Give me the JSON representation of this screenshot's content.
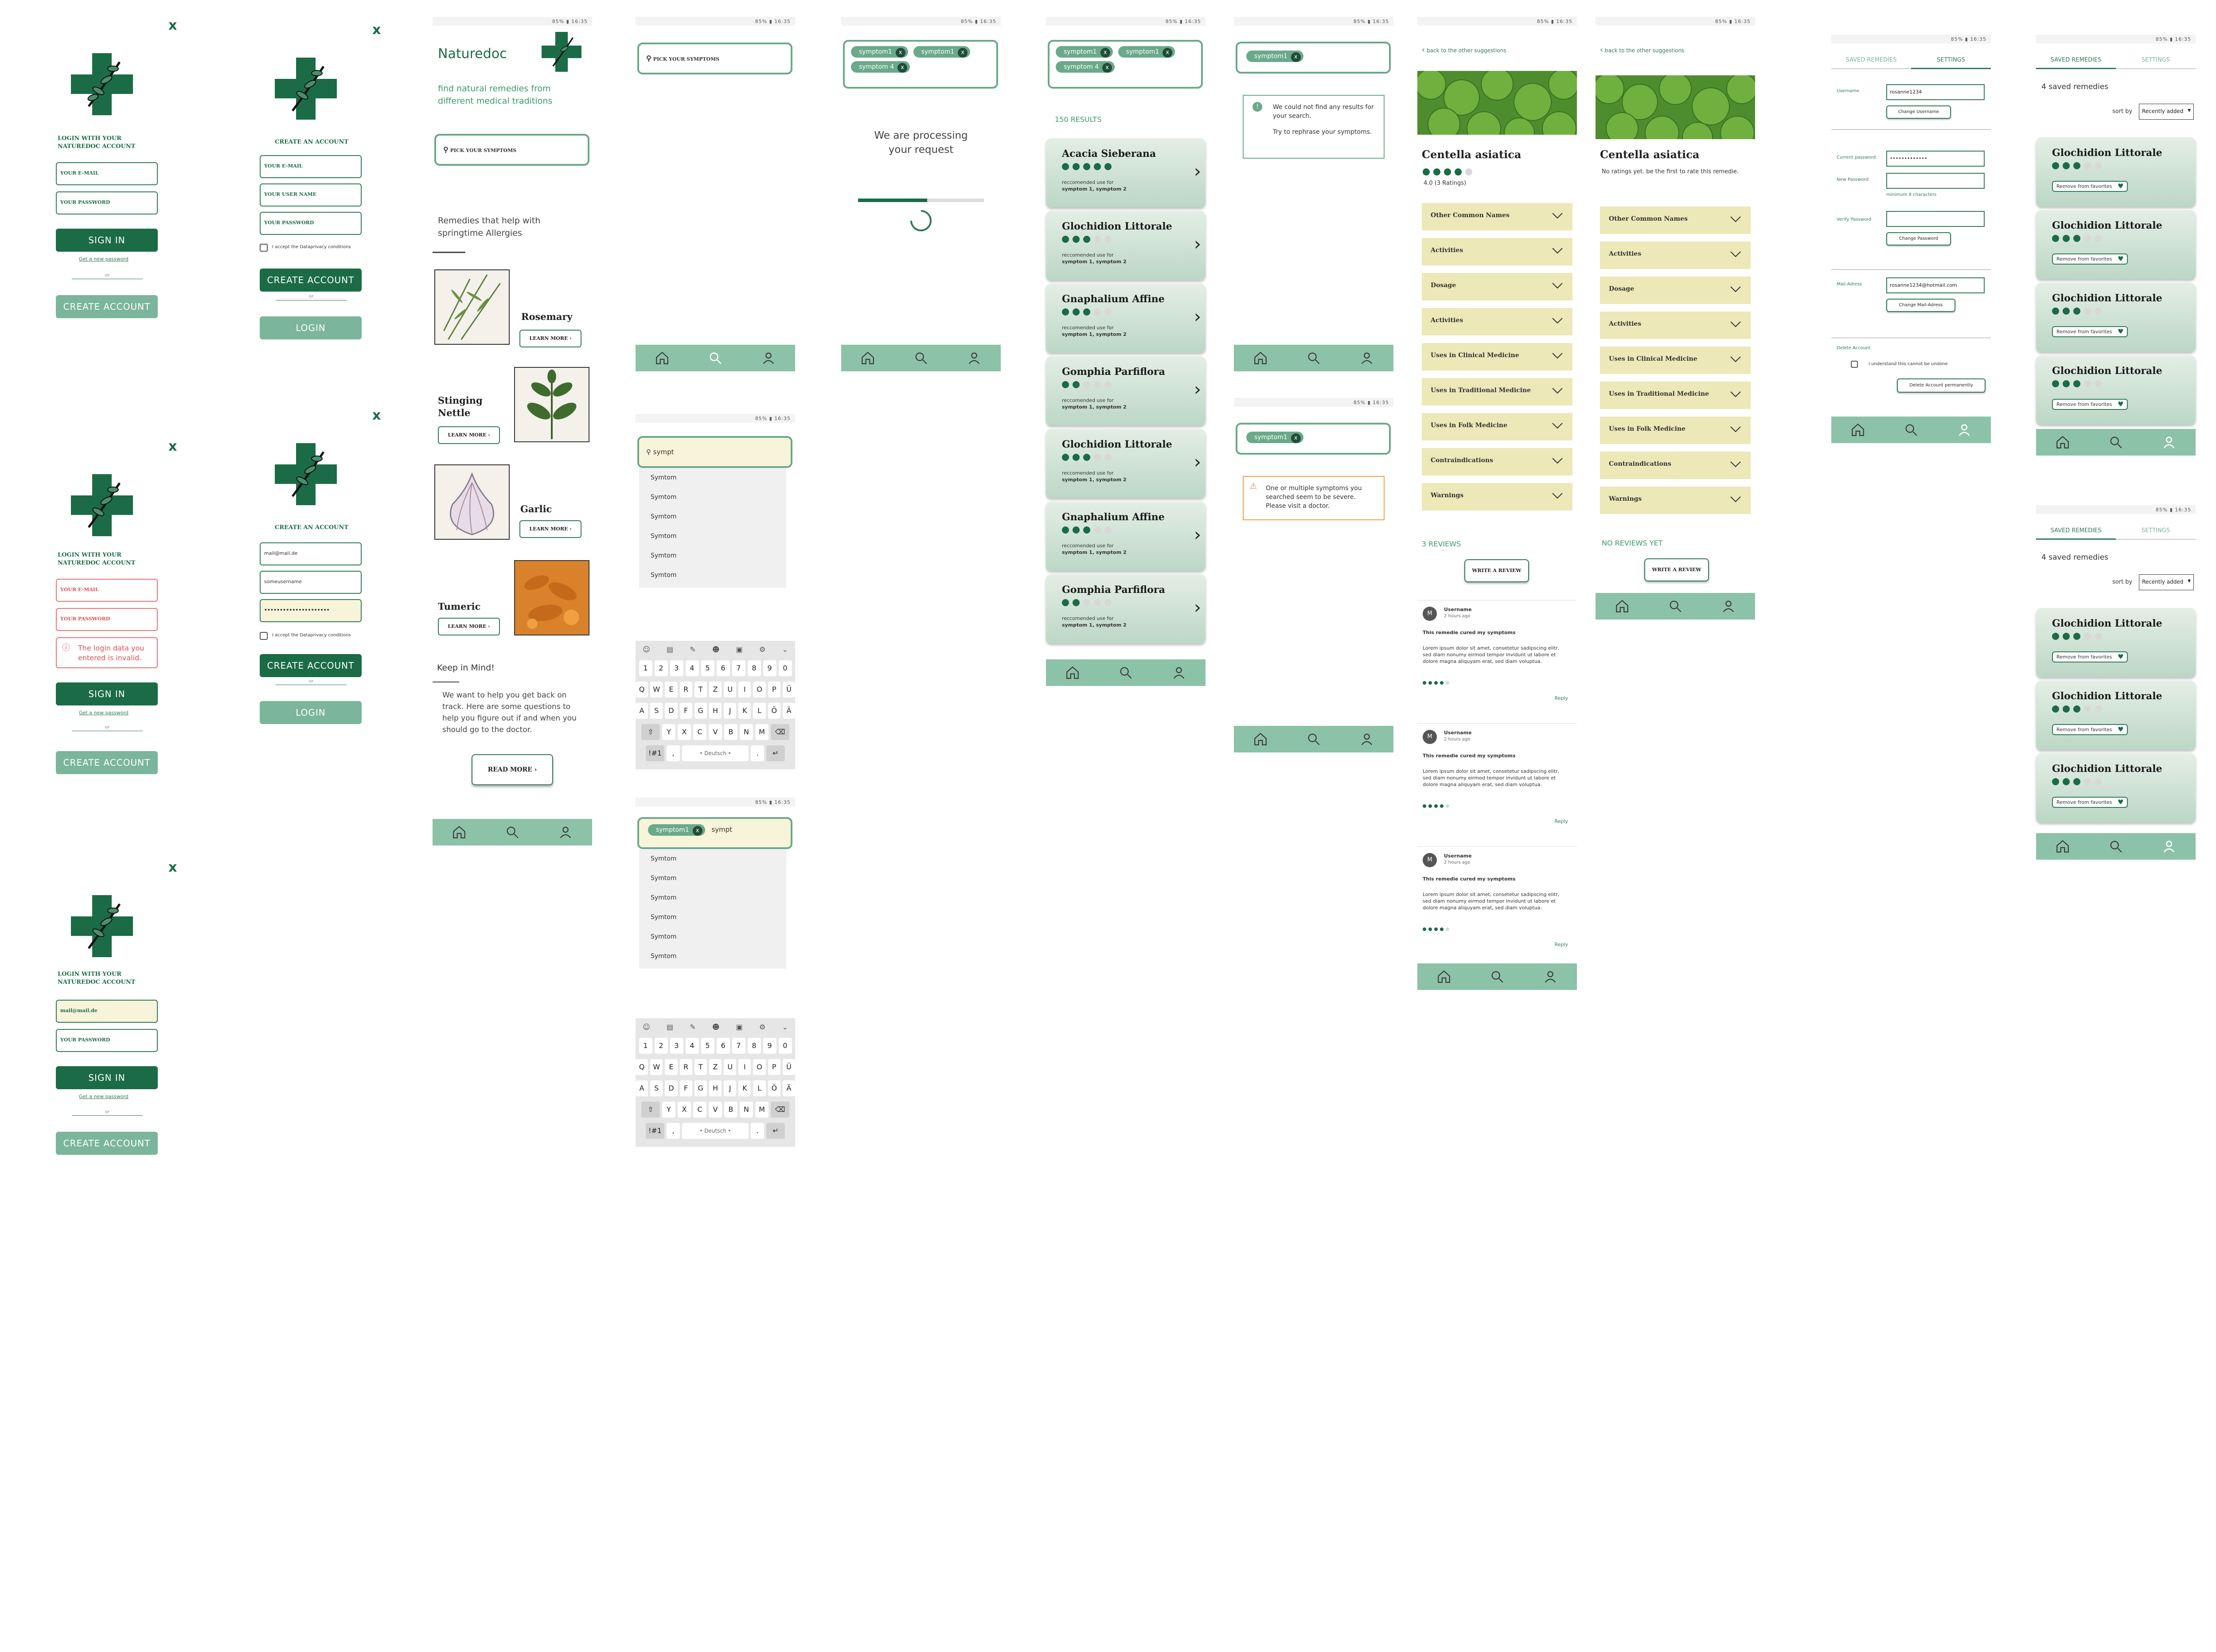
{
  "status": {
    "text": "85% ▮ 16:35"
  },
  "colors": {
    "primary": "#1b6b47",
    "accent": "#7bb59b",
    "nav": "#8cc2a8",
    "error": "#f07070",
    "card": "#bcd7c6",
    "accordion": "#ece8b8"
  },
  "login": {
    "title": "LOGIN WITH YOUR NATUREDOC ACCOUNT",
    "email_ph": "YOUR E-MAIL",
    "password_ph": "YOUR PASSWORD",
    "sign_in": "SIGN IN",
    "forgot": "Get a new password",
    "or": "or",
    "create": "CREATE ACCOUNT",
    "error_text": "The login data you entered is invalid.",
    "filled_email": "mail@mail.de"
  },
  "register": {
    "title": "CREATE AN ACCOUNT",
    "email_ph": "YOUR E-MAIL",
    "user_ph": "YOUR USER NAME",
    "password_ph": "YOUR PASSWORD",
    "accept": "I accept the Dataprivacy conditions",
    "create": "CREATE ACCOUNT",
    "or": "or",
    "login": "LOGIN",
    "filled_email": "mail@mail.de",
    "filled_user": "someusername",
    "filled_pw": "•••••••••••••••••••••"
  },
  "home": {
    "app_name": "Naturedoc",
    "tagline": "find natural remedies from different medical traditions",
    "search_ph": "PICK YOUR SYMPTOMS",
    "section_title": "Remedies that help with springtime Allergies",
    "remedies": [
      {
        "name": "Rosemary",
        "btn": "LEARN MORE"
      },
      {
        "name": "Stinging Nettle",
        "btn": "LEARN MORE"
      },
      {
        "name": "Garlic",
        "btn": "LEARN MORE"
      },
      {
        "name": "Tumeric",
        "btn": "LEARN MORE"
      }
    ],
    "keep_title": "Keep in Mind!",
    "keep_text": "We want to help you get back on track. Here are some questions to help you figure out if and when you should go to the doctor.",
    "read_more": "READ MORE"
  },
  "search": {
    "placeholder": "PICK YOUR SYMPTOMS",
    "typed": "sympt",
    "suggestion": "Symtom",
    "chip1": "symptom1",
    "chip2": "symptom1",
    "chip3": "symptom 4",
    "keyboard_lang": "• Deutsch •",
    "mode": "!#1"
  },
  "processing": {
    "text": "We are processing your request",
    "progress": 0.55
  },
  "results": {
    "count": "150 RESULTS",
    "rec_label": "reccomended use for",
    "rec_value": "symptom 1, symptom 2",
    "items": [
      {
        "name": "Acacia Sieberana",
        "rating": 5
      },
      {
        "name": "Glochidion Littorale",
        "rating": 3
      },
      {
        "name": "Gnaphalium Affine",
        "rating": 3
      },
      {
        "name": "Gomphia Parfiflora",
        "rating": 2
      },
      {
        "name": "Glochidion Littorale",
        "rating": 3
      },
      {
        "name": "Gnaphalium Affine",
        "rating": 3
      },
      {
        "name": "Gomphia Parfiflora",
        "rating": 2
      }
    ]
  },
  "notfound": {
    "chip": "symptom1",
    "msg1": "We could not find any results for your search.",
    "msg2": "Try to rephrase your symptoms.",
    "warn": "One or multiple symptoms you searched seem to be severe. Please visit a doctor."
  },
  "detail": {
    "back": "back to the other suggestions",
    "name": "Centella asiatica",
    "rating_text": "4.0 (3 Ratings)",
    "no_rating": "No ratings yet. be the first to rate this remedie.",
    "sections": [
      "Other Common Names",
      "Activities",
      "Dosage",
      "Activities",
      "Uses in Clinical Medicine",
      "Uses in Traditional Medicine",
      "Uses in Folk Medicine",
      "Contraindications",
      "Warnings"
    ],
    "reviews_count": "3 REVIEWS",
    "no_reviews": "NO REVIEWS YET",
    "write_review": "WRITE A REVIEW",
    "review_user": "Username",
    "review_time": "2 hours ago",
    "review_title": "This remedie cured my symptoms",
    "review_body": "Lorem ipsum dolor sit amet, consetetur sadipscing elitr, sed diam nonumy eirmod tempor invidunt ut labore et dolore magna aliquyam erat, sed diam voluptua.",
    "reply": "Reply"
  },
  "settings": {
    "tab_saved": "SAVED REMEDIES",
    "tab_settings": "SETTINGS",
    "username_label": "Username",
    "username_value": "rosanne1234",
    "change_username": "Change Username",
    "current_pw": "Current password",
    "current_pw_value": "•••••••••••••",
    "new_pw": "New Password",
    "min_chars": "minimum 8 characters",
    "verify_pw": "Verify Password",
    "change_pw": "Change Password",
    "mail_label": "Mail-Adress",
    "mail_value": "rosanne1234@hotmail.com",
    "change_mail": "Change Mail-Adress",
    "delete_label": "Delete Account",
    "understand": "I understand this cannot be undone",
    "delete_btn": "Delete Account permanently"
  },
  "saved": {
    "tab_saved": "SAVED REMEDIES",
    "tab_settings": "SETTINGS",
    "count1": "4 saved remedies",
    "count2": "4 saved remedies",
    "sort_label": "sort by",
    "sort_value": "Recently added",
    "item_name": "Glochidion Littorale",
    "remove": "Remove from favorites"
  }
}
